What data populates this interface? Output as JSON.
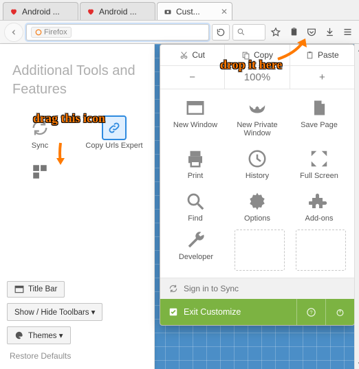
{
  "tabs": [
    {
      "label": "Android ...",
      "favicon": "heart"
    },
    {
      "label": "Android ...",
      "favicon": "heart"
    },
    {
      "label": "Cust...",
      "favicon": "camera",
      "active": true
    }
  ],
  "urlbar": {
    "identity_label": "Firefox"
  },
  "left": {
    "title": "Additional Tools and Features",
    "items": [
      {
        "label": "Sync",
        "icon": "sync"
      },
      {
        "label": "Copy Urls Expert",
        "icon": "copyurls"
      },
      {
        "label": "",
        "icon": "tiles"
      }
    ],
    "footer": {
      "title_bar": "Title Bar",
      "toolbars": "Show / Hide Toolbars ▾",
      "themes": "Themes ▾",
      "restore": "Restore Defaults"
    }
  },
  "menu": {
    "top": {
      "cut": "Cut",
      "copy": "Copy",
      "paste": "Paste"
    },
    "zoom": {
      "level": "100%"
    },
    "grid": {
      "new_window": "New Window",
      "new_private": "New Private Window",
      "save_page": "Save Page",
      "print": "Print",
      "history": "History",
      "fullscreen": "Full Screen",
      "find": "Find",
      "options": "Options",
      "addons": "Add-ons",
      "developer": "Developer"
    },
    "signin": "Sign in to Sync",
    "exit": "Exit Customize"
  },
  "annotations": {
    "drag": "drag this icon",
    "drop": "drop it here"
  }
}
